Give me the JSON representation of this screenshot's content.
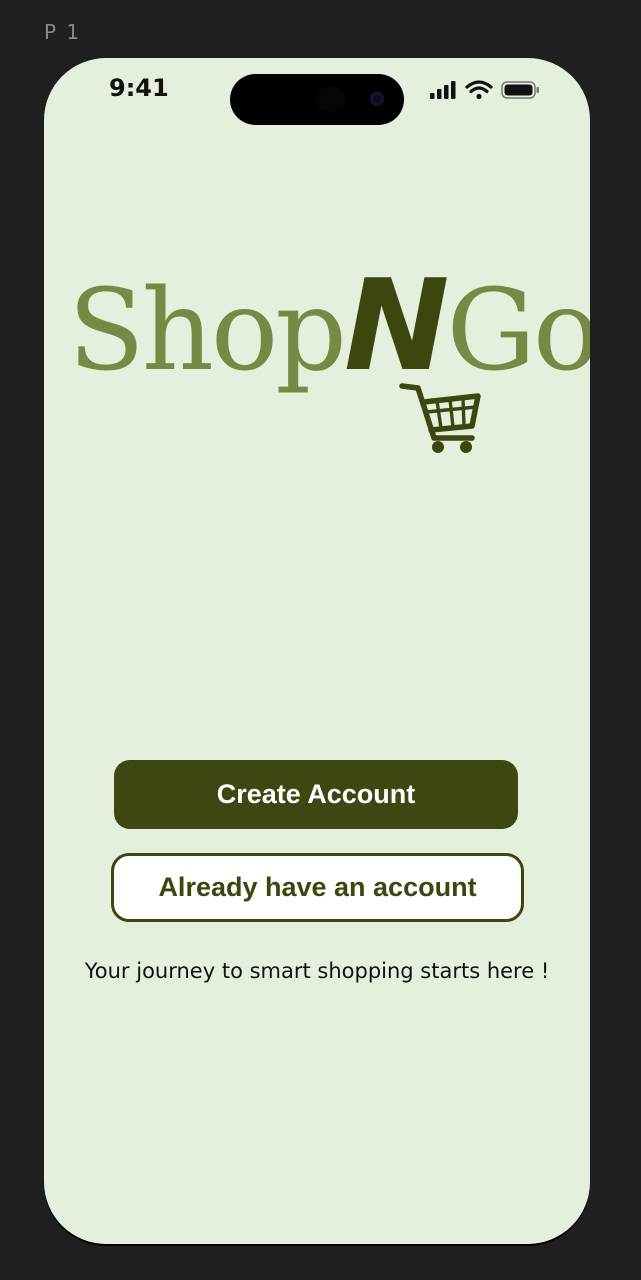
{
  "frame": {
    "label": "P 1"
  },
  "status_bar": {
    "time": "9:41",
    "icons": [
      "signal-bars-icon",
      "wifi-icon",
      "battery-icon"
    ]
  },
  "logo": {
    "part1": "Shop",
    "part2": "N",
    "part3": "Go",
    "icon": "shopping-cart-icon"
  },
  "actions": {
    "create_account": "Create Account",
    "have_account": "Already have an account"
  },
  "tagline": "Your journey to smart shopping starts here !",
  "colors": {
    "background": "#e5efdd",
    "primary": "#3c4711",
    "logo_light": "#768a45",
    "canvas": "#1f1f1f"
  }
}
